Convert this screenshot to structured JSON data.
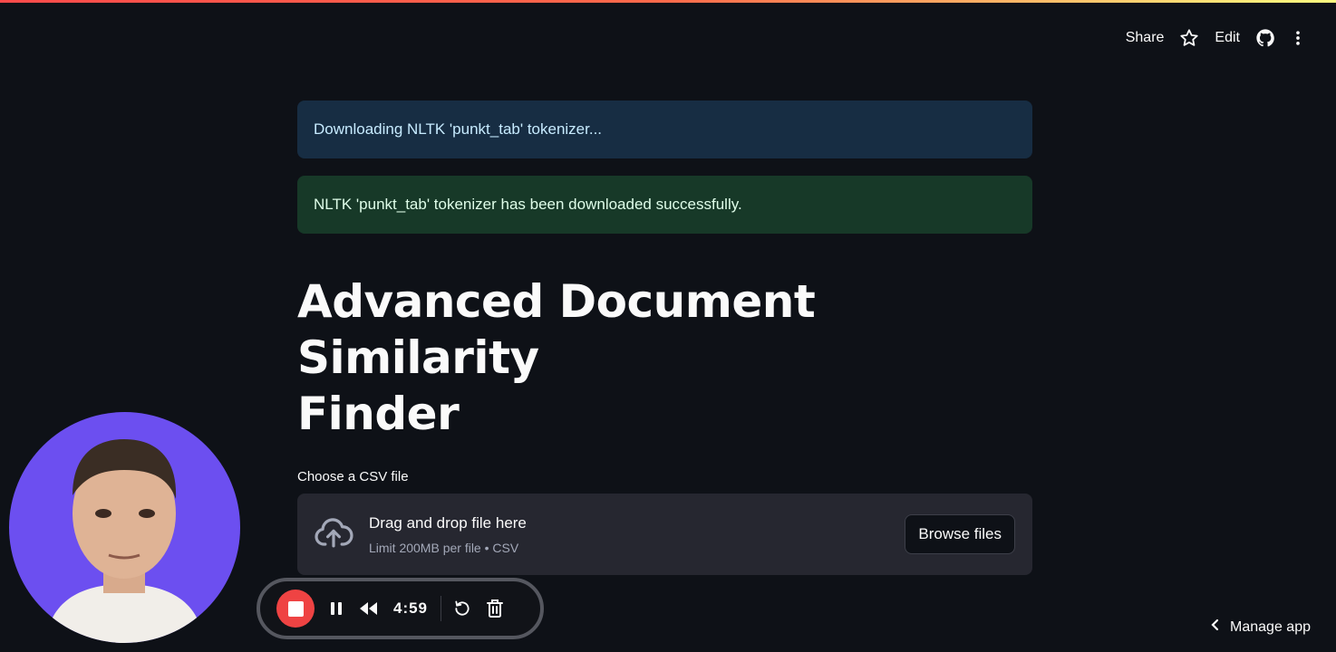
{
  "toolbar": {
    "share_label": "Share",
    "edit_label": "Edit",
    "icons": [
      "star-icon",
      "github-icon",
      "more-vertical-icon"
    ]
  },
  "alerts": {
    "info_text": "Downloading NLTK 'punkt_tab' tokenizer...",
    "success_text": "NLTK 'punkt_tab' tokenizer has been downloaded successfully."
  },
  "page": {
    "title_line1": "Advanced Document Similarity",
    "title_line2": "Finder"
  },
  "uploader": {
    "label": "Choose a CSV file",
    "drag_text": "Drag and drop file here",
    "limit_text": "Limit 200MB per file • CSV",
    "browse_label": "Browse files",
    "icon": "cloud-upload-icon"
  },
  "recorder": {
    "timer": "4:59",
    "icons": [
      "stop-icon",
      "pause-icon",
      "rewind-icon",
      "restart-icon",
      "trash-icon"
    ]
  },
  "footer": {
    "manage_label": "Manage app"
  },
  "colors": {
    "background": "#0e1117",
    "info_bg": "#172d43",
    "success_bg": "#173928",
    "dropzone_bg": "#262730",
    "record_red": "#ef4343",
    "avatar_bg": "#6c4ff0"
  }
}
